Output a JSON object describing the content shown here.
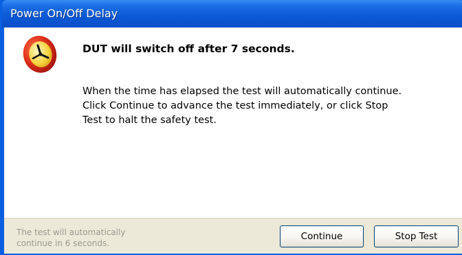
{
  "window": {
    "title": "Power On/Off Delay"
  },
  "dialog": {
    "icon": "clock-icon",
    "heading": "DUT will switch off after 7 seconds.",
    "body_lines": [
      "When the time has elapsed the test will automatically continue.",
      "Click Continue to advance the test immediately, or click Stop",
      "Test to halt the safety test."
    ]
  },
  "footer": {
    "status_lines": [
      "The test will automatically",
      "continue in 6 seconds."
    ],
    "continue_label": "Continue",
    "stop_label": "Stop Test"
  },
  "colors": {
    "titlebar": "#0c58d6",
    "footer_bg": "#ece9d8",
    "icon_red": "#d8261c",
    "icon_yellow": "#f6d23c"
  }
}
